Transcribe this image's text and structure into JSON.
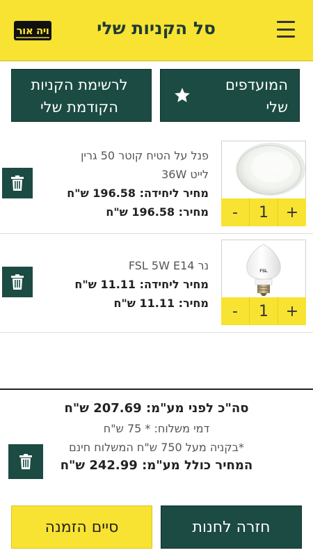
{
  "header": {
    "title": "סל הקניות שלי",
    "logo_text": "ויה אור",
    "menu_icon": "hamburger-icon"
  },
  "top_buttons": {
    "favorites_label": "המועדפים שלי",
    "previous_list_label": "לרשימת הקניות הקודמת שלי"
  },
  "cart": {
    "items": [
      {
        "name": "פנל על הטיח קוטר 50 גרין לייט 36W",
        "unit_price_line": "מחיר ליחידה: 196.58 ש\"ח",
        "price_line": "מחיר: 196.58 ש\"ח",
        "quantity": "1",
        "minus": "-",
        "plus": "+"
      },
      {
        "name": "נר FSL 5W E14",
        "unit_price_line": "מחיר ליחידה: 11.11 ש\"ח",
        "price_line": "מחיר: 11.11 ש\"ח",
        "quantity": "1",
        "minus": "-",
        "plus": "+",
        "bulb_label": "FSL"
      }
    ]
  },
  "summary": {
    "total_before_vat": "סה\"כ לפני מע\"מ: 207.69 ש\"ח",
    "shipping": "דמי משלוח: * 75 ש\"ח",
    "free_shipping_note": "*בקניה מעל 750 ש\"ח המשלוח חינם",
    "total_with_vat": "המחיר כולל מע\"מ: 242.99 ש\"ח"
  },
  "bottom_buttons": {
    "back_to_store": "חזרה לחנות",
    "finish_order": "סיים הזמנה"
  },
  "colors": {
    "brand_yellow": "#f8e332",
    "dark_green": "#1b4b43"
  }
}
